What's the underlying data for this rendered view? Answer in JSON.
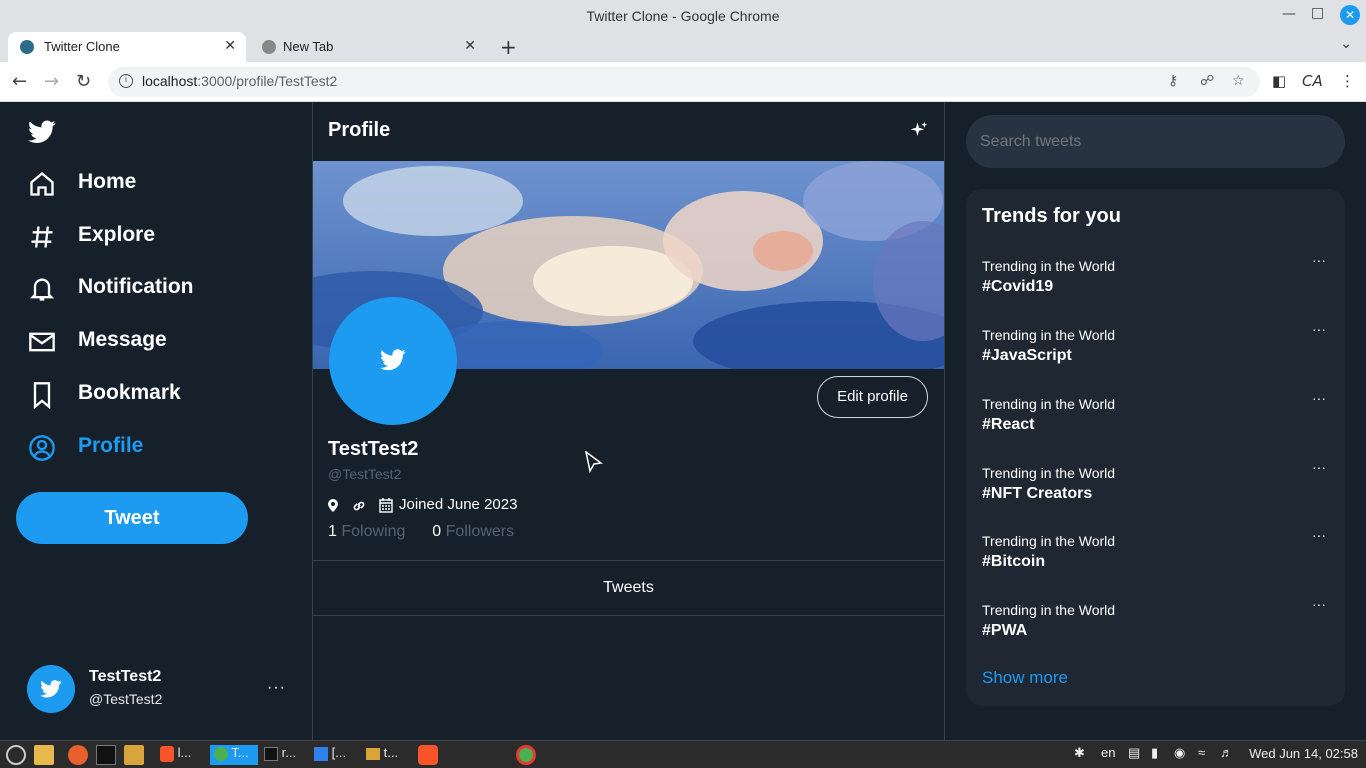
{
  "window": {
    "title": "Twitter Clone - Google Chrome"
  },
  "browser": {
    "tabs": [
      {
        "label": "Twitter Clone",
        "active": true
      },
      {
        "label": "New Tab",
        "active": false
      }
    ],
    "url_host": "localhost",
    "url_rest": ":3000/profile/TestTest2"
  },
  "sidebar": {
    "items": [
      {
        "label": "Home",
        "icon": "home-icon"
      },
      {
        "label": "Explore",
        "icon": "hashtag-icon"
      },
      {
        "label": "Notification",
        "icon": "bell-icon"
      },
      {
        "label": "Message",
        "icon": "mail-icon"
      },
      {
        "label": "Bookmark",
        "icon": "bookmark-icon"
      },
      {
        "label": "Profile",
        "icon": "profile-icon",
        "active": true
      }
    ],
    "tweet_button": "Tweet",
    "account": {
      "name": "TestTest2",
      "handle": "@TestTest2",
      "more": "···"
    }
  },
  "main": {
    "header": "Profile",
    "edit_button": "Edit profile",
    "name": "TestTest2",
    "handle": "@TestTest2",
    "joined": "Joined June 2023",
    "following_count": "1",
    "following_label": "Folowing",
    "followers_count": "0",
    "followers_label": "Followers",
    "tab": "Tweets"
  },
  "right": {
    "search_placeholder": "Search tweets",
    "trends_title": "Trends for you",
    "trends": [
      {
        "caption": "Trending in the World",
        "tag": "#Covid19"
      },
      {
        "caption": "Trending in the World",
        "tag": "#JavaScript"
      },
      {
        "caption": "Trending in the World",
        "tag": "#React"
      },
      {
        "caption": "Trending in the World",
        "tag": "#NFT Creators"
      },
      {
        "caption": "Trending in the World",
        "tag": "#Bitcoin"
      },
      {
        "caption": "Trending in the World",
        "tag": "#PWA"
      }
    ],
    "trend_more": "···",
    "show_more": "Show more"
  },
  "taskbar": {
    "items": [
      "l...",
      "T...",
      "r...",
      "[...",
      "t..."
    ],
    "lang": "en",
    "clock": "Wed Jun 14, 02:58"
  },
  "colors": {
    "accent": "#1d9bf0",
    "background": "#15202b",
    "panel": "#1e2732"
  }
}
